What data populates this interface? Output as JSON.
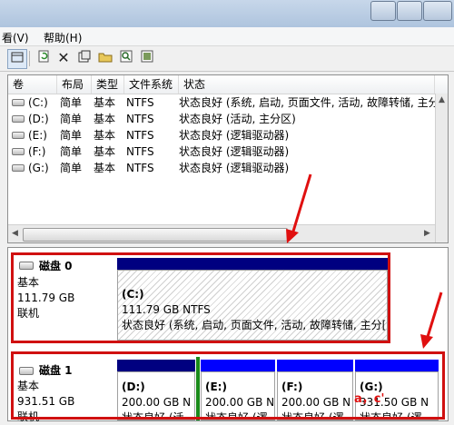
{
  "window": {
    "title_fragment": ""
  },
  "menu": {
    "items": [
      {
        "label": "看(V)"
      },
      {
        "label": "帮助(H)"
      }
    ]
  },
  "toolbar": {
    "icons": [
      "view-icon",
      "refresh-icon",
      "delete-icon",
      "properties-icon",
      "open-icon",
      "search-icon",
      "help-icon"
    ]
  },
  "volume_list": {
    "columns": [
      "卷",
      "布局",
      "类型",
      "文件系统",
      "状态"
    ],
    "rows": [
      {
        "volume": "(C:)",
        "layout": "简单",
        "type": "基本",
        "fs": "NTFS",
        "status": "状态良好 (系统, 启动, 页面文件, 活动, 故障转储, 主分区)"
      },
      {
        "volume": "(D:)",
        "layout": "简单",
        "type": "基本",
        "fs": "NTFS",
        "status": "状态良好 (活动, 主分区)"
      },
      {
        "volume": "(E:)",
        "layout": "简单",
        "type": "基本",
        "fs": "NTFS",
        "status": "状态良好 (逻辑驱动器)"
      },
      {
        "volume": "(F:)",
        "layout": "简单",
        "type": "基本",
        "fs": "NTFS",
        "status": "状态良好 (逻辑驱动器)"
      },
      {
        "volume": "(G:)",
        "layout": "简单",
        "type": "基本",
        "fs": "NTFS",
        "status": "状态良好 (逻辑驱动器)"
      }
    ]
  },
  "disks": [
    {
      "name": "磁盘 0",
      "type": "基本",
      "size": "111.79 GB",
      "state": "联机",
      "partitions": [
        {
          "label": "(C:)",
          "size": "111.79 GB NTFS",
          "status": "状态良好 (系统, 启动, 页面文件, 活动, 故障转储, 主分["
        }
      ]
    },
    {
      "name": "磁盘 1",
      "type": "基本",
      "size": "931.51 GB",
      "state": "联机",
      "partitions": [
        {
          "label": "(D:)",
          "size": "200.00 GB N",
          "status": "状态良好 (活"
        },
        {
          "label": "(E:)",
          "size": "200.00 GB N",
          "status": "状态良好 (逻"
        },
        {
          "label": "(F:)",
          "size": "200.00 GB N",
          "status": "状态良好 (逻"
        },
        {
          "label": "(G:)",
          "size": "331.50 GB N",
          "status": "状态良好 (逻"
        }
      ]
    }
  ],
  "colors": {
    "primary_partition": "#000080",
    "logical_partition": "#0000ff",
    "annotation": "#d01010"
  },
  "watermark": {
    "text": "a，c'"
  }
}
